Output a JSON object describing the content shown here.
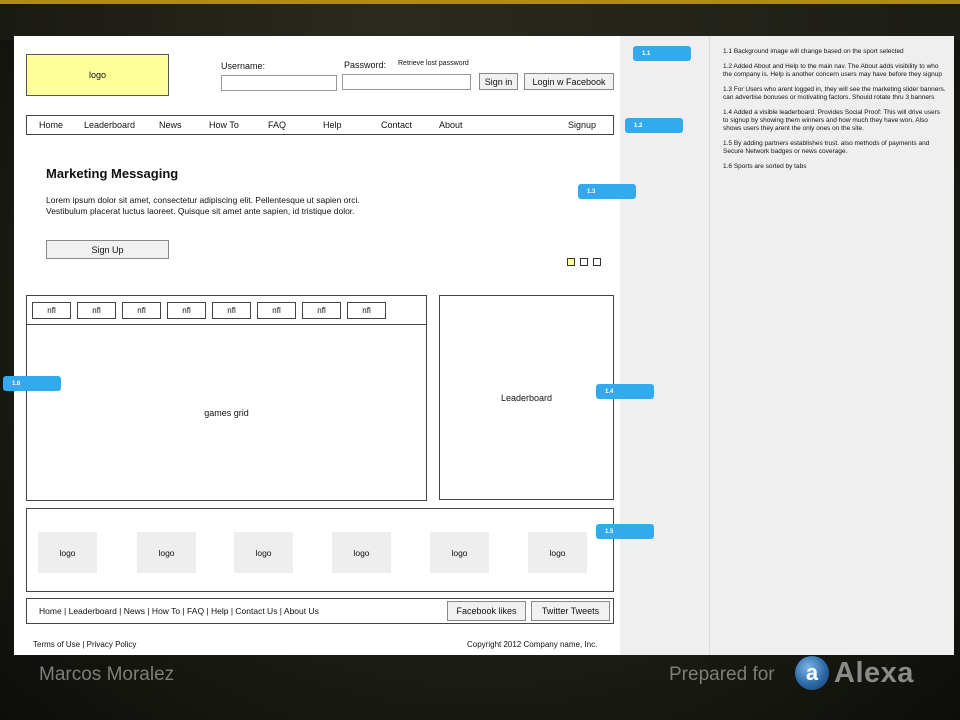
{
  "header": {
    "logo_label": "logo",
    "username_label": "Username:",
    "password_label": "Password:",
    "retrieve_link": "Retrieve lost password",
    "sign_in": "Sign in",
    "facebook_login": "Login w Facebook"
  },
  "nav": {
    "items": [
      "Home",
      "Leaderboard",
      "News",
      "How To",
      "FAQ",
      "Help",
      "Contact",
      "About"
    ],
    "signup": "Signup"
  },
  "hero": {
    "title": "Marketing Messaging",
    "body_line1": "Lorem ipsum dolor sit amet, consectetur adipiscing elit. Pellentesque ut sapien orci.",
    "body_line2": "Vestibulum placerat luctus laoreet. Quisque sit amet ante sapien, id tristique dolor.",
    "signup_button": "Sign Up",
    "slides_total": 3,
    "slide_active": 1
  },
  "tabs": [
    "nfl",
    "nfl",
    "nfl",
    "nfl",
    "nfl",
    "nfl",
    "nfl",
    "nfl"
  ],
  "games_grid_label": "games grid",
  "leaderboard_label": "Leaderboard",
  "partner_logos": [
    "logo",
    "logo",
    "logo",
    "logo",
    "logo",
    "logo"
  ],
  "footer": {
    "links": "Home | Leaderboard | News | How To | FAQ | Help |  Contact Us | About Us",
    "facebook_likes": "Facebook likes",
    "twitter_tweets": "Twitter Tweets",
    "terms": "Terms of Use | Privacy Policy",
    "copyright": "Copyright  2012 Company name, Inc."
  },
  "callouts": {
    "c11": "1.1",
    "c12": "1.2",
    "c13": "1.3",
    "c14": "1.4",
    "c15": "1.5",
    "c16": "1.6"
  },
  "notes": [
    "1.1 Background image will change based on the sport selected",
    "1.2  Added About  and Help to the main nav. The About adds visibility to who the company is. Help is another concern users may have before they signup",
    "1.3  For Users who arent logged in, they will see the marketing slider banners. can advertise bonuses or motivating factors. Should rotate thru 3 banners",
    "1.4  Added a visible leaderboard. Provides Social Proof: This will drive users to signup by showing them winners and how much they have won. Also shows users they arent the only ones on the site.",
    "1.5  By adding partners establishes trust. also methods of payments and Secure Network badges or news coverage.",
    "1.6  Sports are sorted by tabs"
  ],
  "slide_footer": {
    "author": "Marcos Moralez",
    "prepared_for": "Prepared for",
    "brand_mark": "a",
    "brand": "Alexa"
  },
  "colors": {
    "callout": "#33aaee",
    "logo_fill": "#ffff99",
    "accent_bar": "#b08a1a"
  }
}
